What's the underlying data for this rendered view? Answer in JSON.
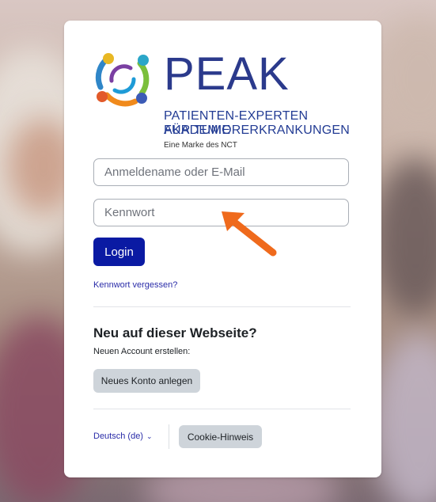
{
  "logo": {
    "word": "PEAK",
    "line1": "PATIENTEN-EXPERTEN AKADEMIE",
    "line2": "FÜR TUMORERKRANKUNGEN",
    "brand": "Eine Marke des NCT"
  },
  "login": {
    "username_placeholder": "Anmeldename oder E-Mail",
    "username_value": "",
    "password_placeholder": "Kennwort",
    "password_value": "",
    "submit_label": "Login",
    "forgot_link": "Kennwort vergessen?"
  },
  "signup": {
    "heading": "Neu auf dieser Webseite?",
    "subtext": "Neuen Account erstellen:",
    "button_label": "Neues Konto anlegen"
  },
  "footer": {
    "language": "Deutsch (de)",
    "cookie_button": "Cookie-Hinweis"
  },
  "colors": {
    "primary": "#0a1aa3",
    "link": "#2a2ca8",
    "annotation_arrow": "#ef6a1c"
  },
  "icons": {
    "language_dropdown": "chevron-down-icon",
    "annotation": "arrow-icon"
  }
}
